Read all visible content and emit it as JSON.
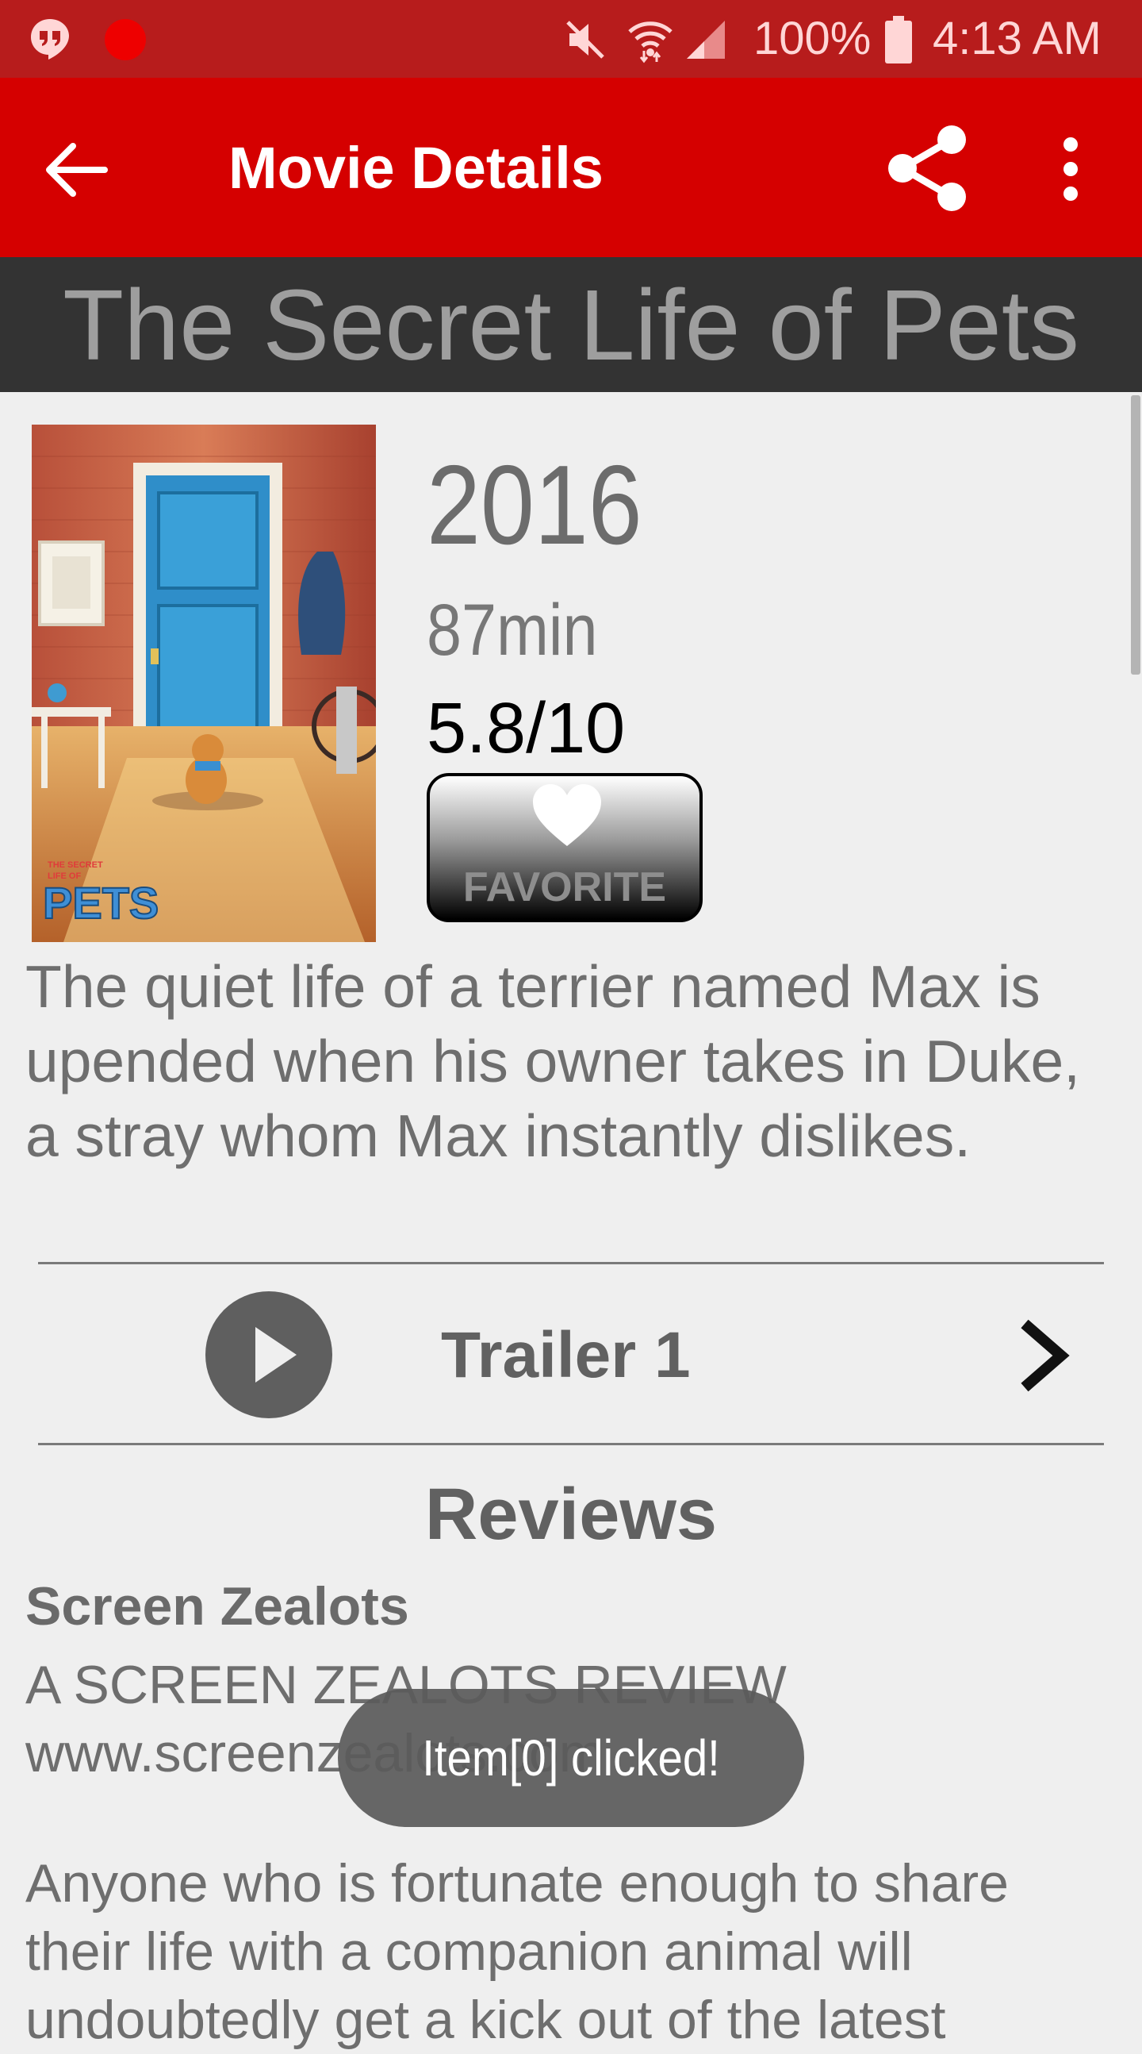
{
  "status_bar": {
    "battery_percent": "100%",
    "time": "4:13 AM",
    "icons": [
      "hangouts-icon",
      "recording-dot-icon",
      "mute-icon",
      "wifi-icon",
      "cell-signal-icon",
      "battery-icon"
    ]
  },
  "app_bar": {
    "title": "Movie Details",
    "back_icon": "arrow-back-icon",
    "share_icon": "share-icon",
    "menu_icon": "more-vert-icon"
  },
  "movie": {
    "title": "The Secret Life of Pets",
    "year": "2016",
    "runtime": "87min",
    "rating": "5.8/10",
    "favorite_label": "FAVORITE",
    "overview": "The quiet life of a terrier named Max is upended when his owner takes in Duke, a stray whom Max instantly dislikes.",
    "poster_lettering": [
      "THE SECRET LIFE OF",
      "PETS"
    ]
  },
  "trailers": [
    {
      "label": "Trailer 1"
    }
  ],
  "reviews": {
    "heading": "Reviews",
    "items": [
      {
        "author": "Screen Zealots",
        "body": "A SCREEN ZEALOTS REVIEW\nwww.screenzealots.com",
        "body2": "Anyone who is fortunate enough to share their life with a companion animal will undoubtedly get a kick out of the latest"
      }
    ]
  },
  "toast": {
    "text": "Item[0] clicked!"
  },
  "colors": {
    "status_bar": "#b71c1c",
    "app_bar": "#d50000",
    "title_banner": "#333333",
    "background": "#efefef"
  }
}
